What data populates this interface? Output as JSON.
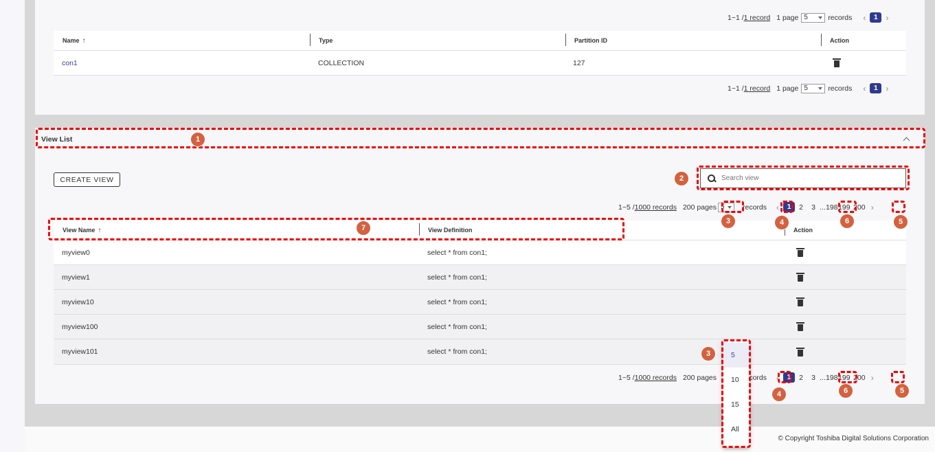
{
  "footer": {
    "copyright": "© Copyright Toshiba Digital Solutions Corporation"
  },
  "partition_table": {
    "pager_top": {
      "range": "1~1 / ",
      "records_link": "1 record",
      "pages": "1 page",
      "page_size": "5",
      "records_word": "records",
      "current_page": "1"
    },
    "headers": {
      "name": "Name",
      "type": "Type",
      "partition_id": "Partition ID",
      "action": "Action"
    },
    "rows": [
      {
        "name": "con1",
        "type": "COLLECTION",
        "partition_id": "127"
      }
    ],
    "pager_bottom": {
      "range": "1~1 / ",
      "records_link": "1 record",
      "pages": "1 page",
      "page_size": "5",
      "records_word": "records",
      "current_page": "1"
    }
  },
  "view_list": {
    "title": "View List",
    "create_button": "CREATE VIEW",
    "search_placeholder": "Search view",
    "pager": {
      "range": "1~5 / ",
      "records_link": "1000 records",
      "pages": "200 pages",
      "page_size": "5",
      "records_word": "records",
      "pages_list": [
        "1",
        "2",
        "3",
        "...",
        "198",
        "199",
        "200"
      ]
    },
    "headers": {
      "view_name": "View Name",
      "view_definition": "View Definition",
      "action": "Action"
    },
    "rows": [
      {
        "name": "myview0",
        "definition": "select * from con1;"
      },
      {
        "name": "myview1",
        "definition": "select * from con1;"
      },
      {
        "name": "myview10",
        "definition": "select * from con1;"
      },
      {
        "name": "myview100",
        "definition": "select * from con1;"
      },
      {
        "name": "myview101",
        "definition": "select * from con1;"
      }
    ],
    "page_size_options": [
      "5",
      "10",
      "15",
      "All"
    ]
  },
  "annotations": {
    "b1": "1",
    "b2": "2",
    "b3": "3",
    "b4": "4",
    "b5": "5",
    "b6": "6",
    "b7": "7"
  },
  "icons": {
    "sort": "arrow-up-icon",
    "delete": "trash-icon",
    "search": "search-icon",
    "collapse": "chevron-up-icon"
  },
  "colors": {
    "accent": "#2f3a8f",
    "annotation": "#d4613f",
    "highlight": "#ee0000"
  }
}
